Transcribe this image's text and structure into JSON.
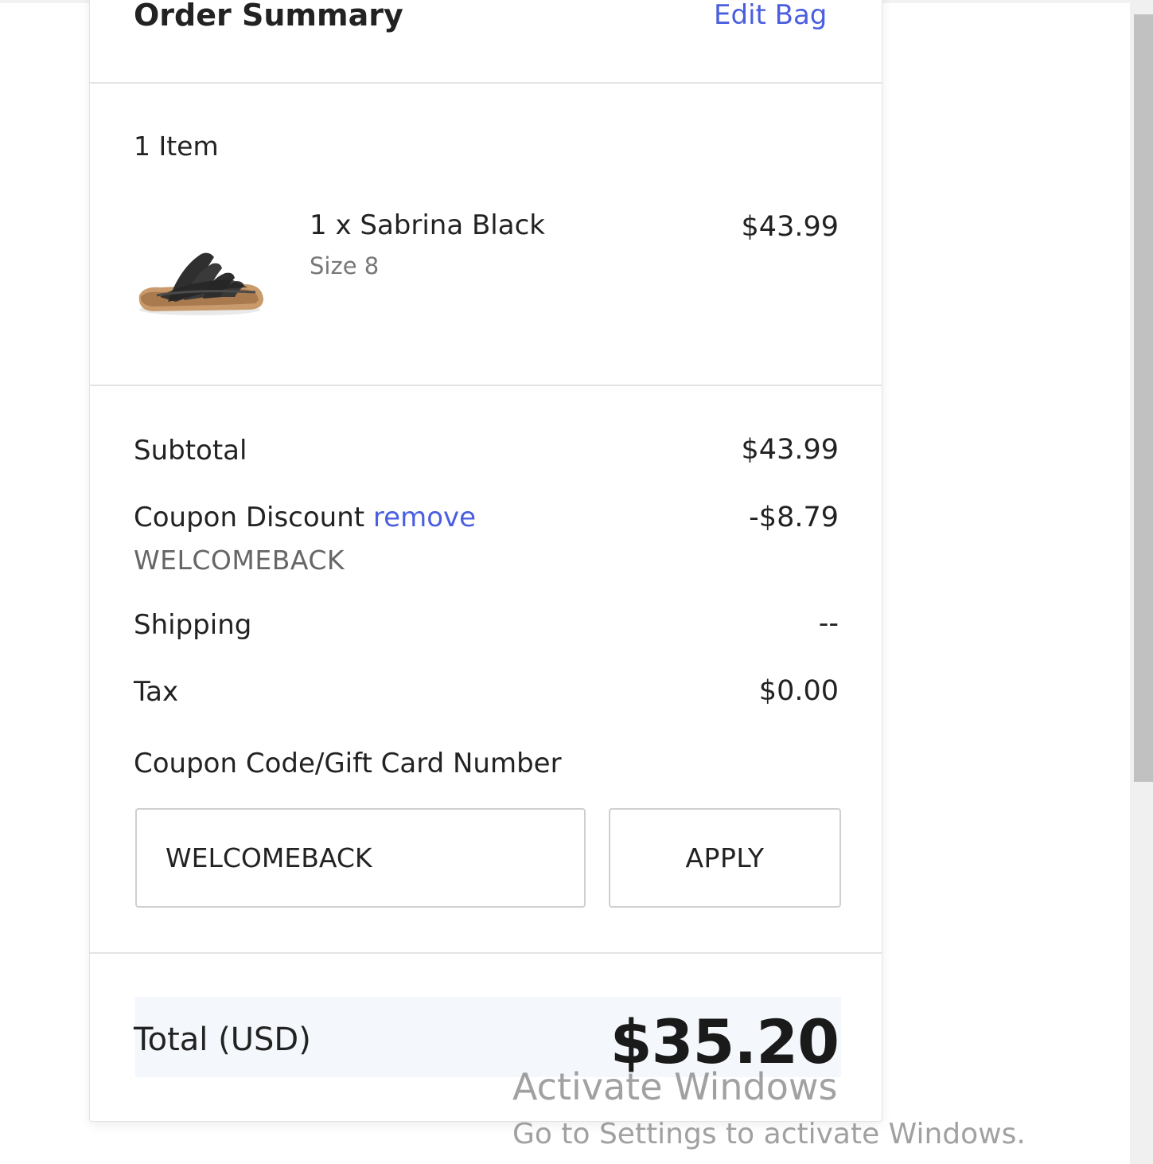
{
  "order_summary": {
    "title": "Order Summary",
    "edit_bag": "Edit Bag",
    "item_count": "1 Item",
    "item": {
      "name": "1 x Sabrina Black",
      "size": "Size 8",
      "price": "$43.99",
      "thumbnail_icon": "sandal-image"
    },
    "rows": {
      "subtotal_label": "Subtotal",
      "subtotal_value": "$43.99",
      "coupon_label": "Coupon Discount",
      "coupon_remove": "remove",
      "coupon_value": "-$8.79",
      "coupon_code": "WELCOMEBACK",
      "shipping_label": "Shipping",
      "shipping_value": "--",
      "tax_label": "Tax",
      "tax_value": "$0.00"
    },
    "coupon_form": {
      "label": "Coupon Code/Gift Card Number",
      "input_value": "WELCOMEBACK",
      "apply_label": "APPLY"
    },
    "total": {
      "label": "Total (USD)",
      "value": "$35.20"
    }
  },
  "watermark": {
    "line1": "Activate Windows",
    "line2": "Go to Settings to activate Windows."
  },
  "colors": {
    "link": "#4a5ee0",
    "total_band": "#f4f7fb",
    "border": "#e3e3e3"
  }
}
